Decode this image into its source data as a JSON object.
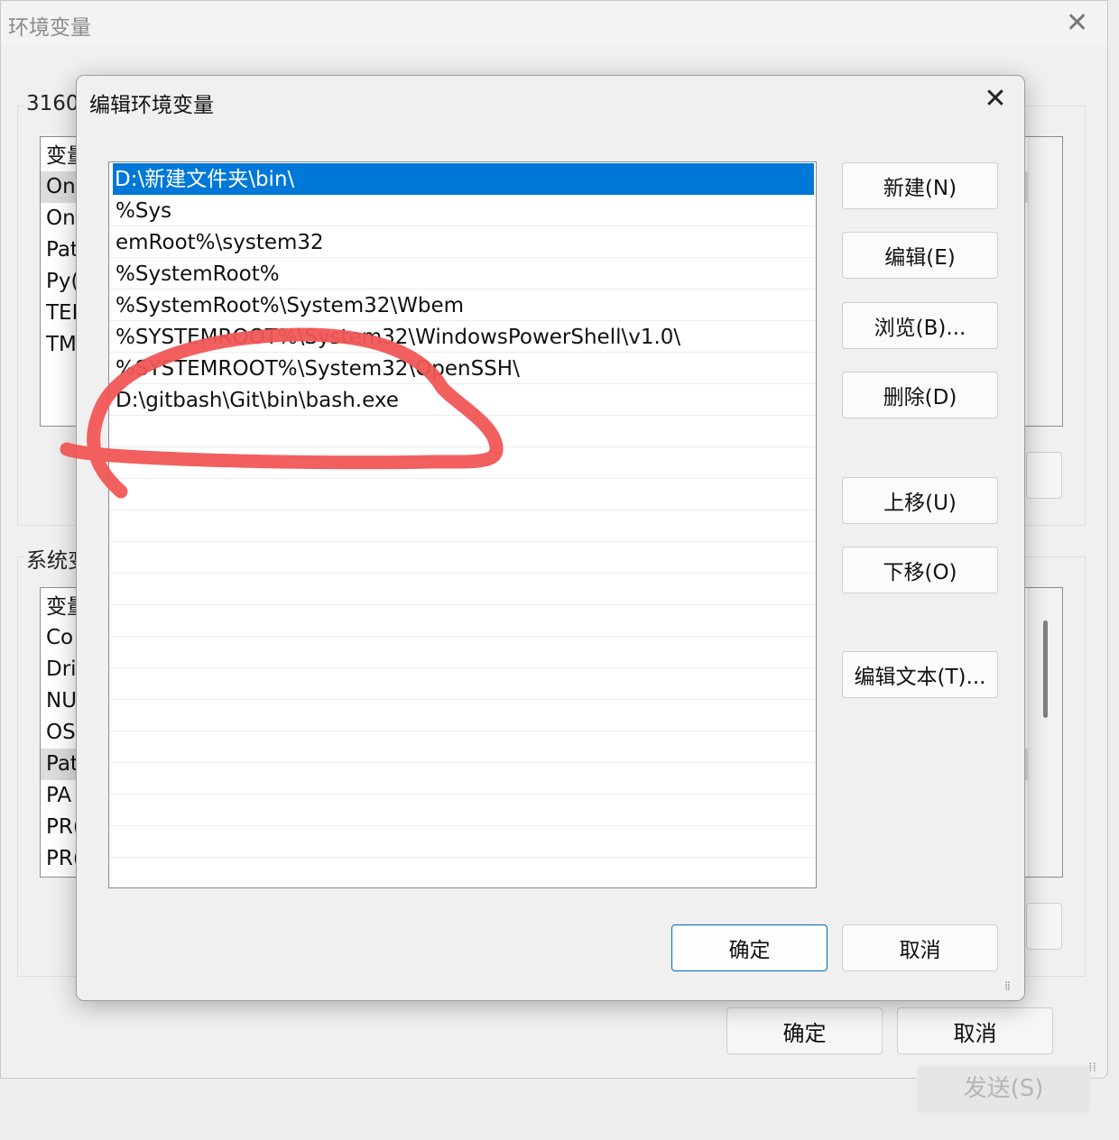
{
  "parent_window": {
    "title": "环境变量",
    "user_group_label": "3160",
    "user_list": {
      "header": "变量",
      "items": [
        "One",
        "One",
        "Pat",
        "Py(",
        "TEI",
        "TM"
      ]
    },
    "system_group_label": "系统变",
    "system_list": {
      "header": "变量",
      "items": [
        "Co",
        "Dri",
        "NU",
        "OS",
        "Pat",
        "PA",
        "PR(",
        "PR("
      ]
    },
    "ok_label": "确定",
    "cancel_label": "取消"
  },
  "background_app": {
    "send_label": "发送(S)"
  },
  "dialog": {
    "title": "编辑环境变量",
    "paths": [
      "D:\\新建文件夹\\bin\\",
      "%Sys",
      "emRoot%\\system32",
      "%SystemRoot%",
      "%SystemRoot%\\System32\\Wbem",
      "%SYSTEMROOT%\\System32\\WindowsPowerShell\\v1.0\\",
      "%SYSTEMROOT%\\System32\\OpenSSH\\",
      "D:\\gitbash\\Git\\bin\\bash.exe"
    ],
    "selected_index": 0,
    "buttons": {
      "new": "新建(N)",
      "edit": "编辑(E)",
      "browse": "浏览(B)...",
      "delete": "删除(D)",
      "move_up": "上移(U)",
      "move_down": "下移(O)",
      "edit_text": "编辑文本(T)...",
      "ok": "确定",
      "cancel": "取消"
    }
  },
  "colors": {
    "selection": "#0078d7",
    "annotation": "#f05656",
    "primary_border": "#0067c0"
  }
}
